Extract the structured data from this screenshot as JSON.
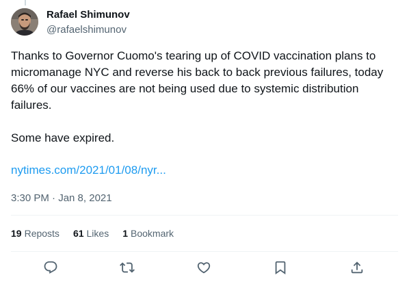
{
  "author": {
    "name": "Rafael Shimunov",
    "handle": "@rafaelshimunov"
  },
  "tweet": {
    "paragraph_1": "Thanks to Governor Cuomo's tearing up of COVID vaccination plans to micromanage NYC and reverse his back to back previous failures, today 66% of our vaccines are not being used due to systemic distribution failures.",
    "paragraph_2": "Some have expired.",
    "link_text": "nytimes.com/2021/01/08/nyr...",
    "timestamp": "3:30 PM · Jan 8, 2021"
  },
  "stats": {
    "reposts_count": "19",
    "reposts_label": "Reposts",
    "likes_count": "61",
    "likes_label": "Likes",
    "bookmarks_count": "1",
    "bookmarks_label": "Bookmark"
  },
  "actions": {
    "icons": [
      "reply-icon",
      "repost-icon",
      "like-icon",
      "bookmark-icon",
      "share-icon"
    ]
  },
  "colors": {
    "text": "#0f1419",
    "secondary_text": "#536471",
    "link": "#1d9bf0",
    "divider": "#eff3f4"
  }
}
